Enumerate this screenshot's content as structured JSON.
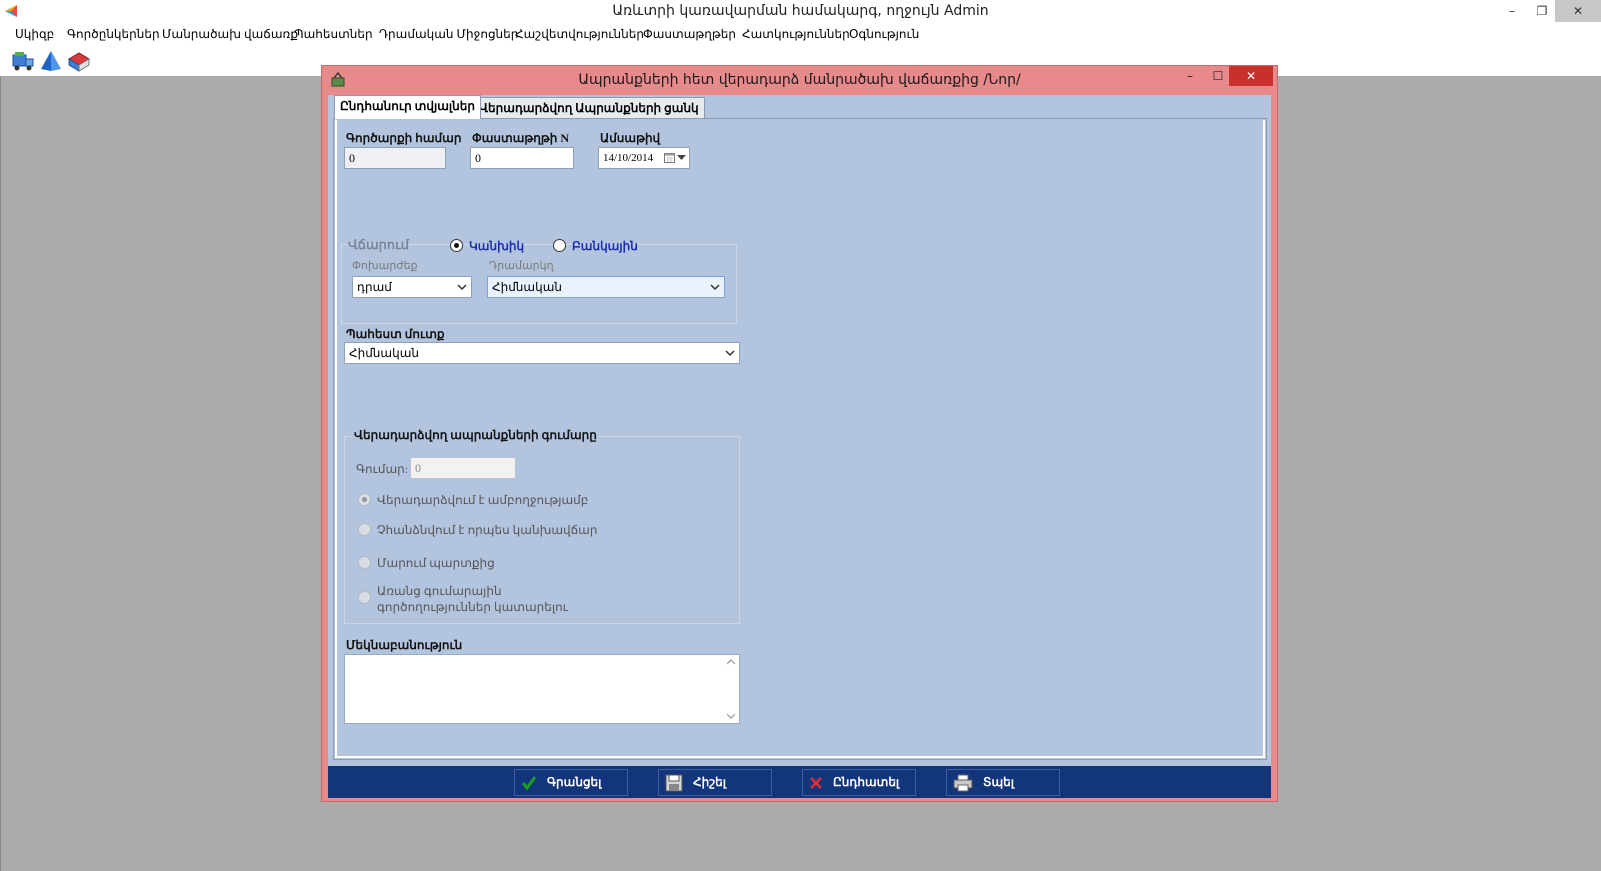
{
  "window": {
    "title": "Առևտրի կառավարման համակարգ, ողջույն Admin",
    "controls": {
      "minimize": "–",
      "maximize": "❐",
      "close": "✕"
    }
  },
  "menu": {
    "items": [
      "Սկիզբ",
      "Գործընկերներ",
      "Մանրածախ վաճառք",
      "Պահեստներ",
      "Դրամական Միջոցներ",
      "Հաշվետվություններ",
      "Փաստաթղթեր",
      "Հատկություններ",
      "Օգնություն"
    ]
  },
  "dialog": {
    "title": "Ապրանքների հետ վերադարձ մանրածախ վաճառքից /Նոր/",
    "controls": {
      "minimize": "–",
      "maximize": "☐",
      "close": "✕"
    },
    "tabs": [
      "Ընդհանուր տվյալներ",
      "Վերադարձվող Ապրանքների ցանկ"
    ],
    "fields": {
      "operation_number": {
        "label": "Գործարքի համար",
        "value": "0"
      },
      "document_number": {
        "label": "Փաստաթղթի N",
        "value": "0"
      },
      "date": {
        "label": "Ամսաթիվ",
        "value": "14/10/2014"
      }
    },
    "payment": {
      "label": "Վճարում",
      "options": [
        "Կանխիկ",
        "Բանկային"
      ],
      "selected": "Կանխիկ",
      "currency_label": "Փոխարժեք",
      "currency_value": "դրամ",
      "cashbox_label": "Դրամարկղ",
      "cashbox_value": "Հիմնական"
    },
    "warehouse": {
      "label": "Պահեստ մուտք",
      "value": "Հիմնական"
    },
    "refund": {
      "group_label": "Վերադարձվող ապրանքների գումարը",
      "amount_label": "Գումար:",
      "amount_value": "0",
      "options": [
        "Վերադարձվում է ամբողջությամբ",
        "Չհանձնվում է որպես կանխավճար",
        "Մարում պարտքից",
        "Առանց գումարային",
        "գործողություններ կատարելու"
      ]
    },
    "note_label": "Մեկնաբանություն",
    "buttons": [
      "Գրանցել",
      "Հիշել",
      "Ընդհատել",
      "Տպել"
    ]
  },
  "colors": {
    "dialog_frame": "#e8898b",
    "dialog_body": "#b3c5de",
    "button_bar": "#12357b",
    "close_red": "#c9302b",
    "radio_blue_text": "#1b2fb0",
    "desktop": "#ababab"
  },
  "icons": {
    "app_logo": "colorful-triangle-icon",
    "toolbar": [
      "truck-icon",
      "pyramid-icon",
      "book-stack-icon"
    ],
    "dialog_icon": "basket-icon",
    "buttons": [
      "checkmark-icon",
      "floppy-disk-icon",
      "red-x-icon",
      "printer-icon"
    ]
  }
}
